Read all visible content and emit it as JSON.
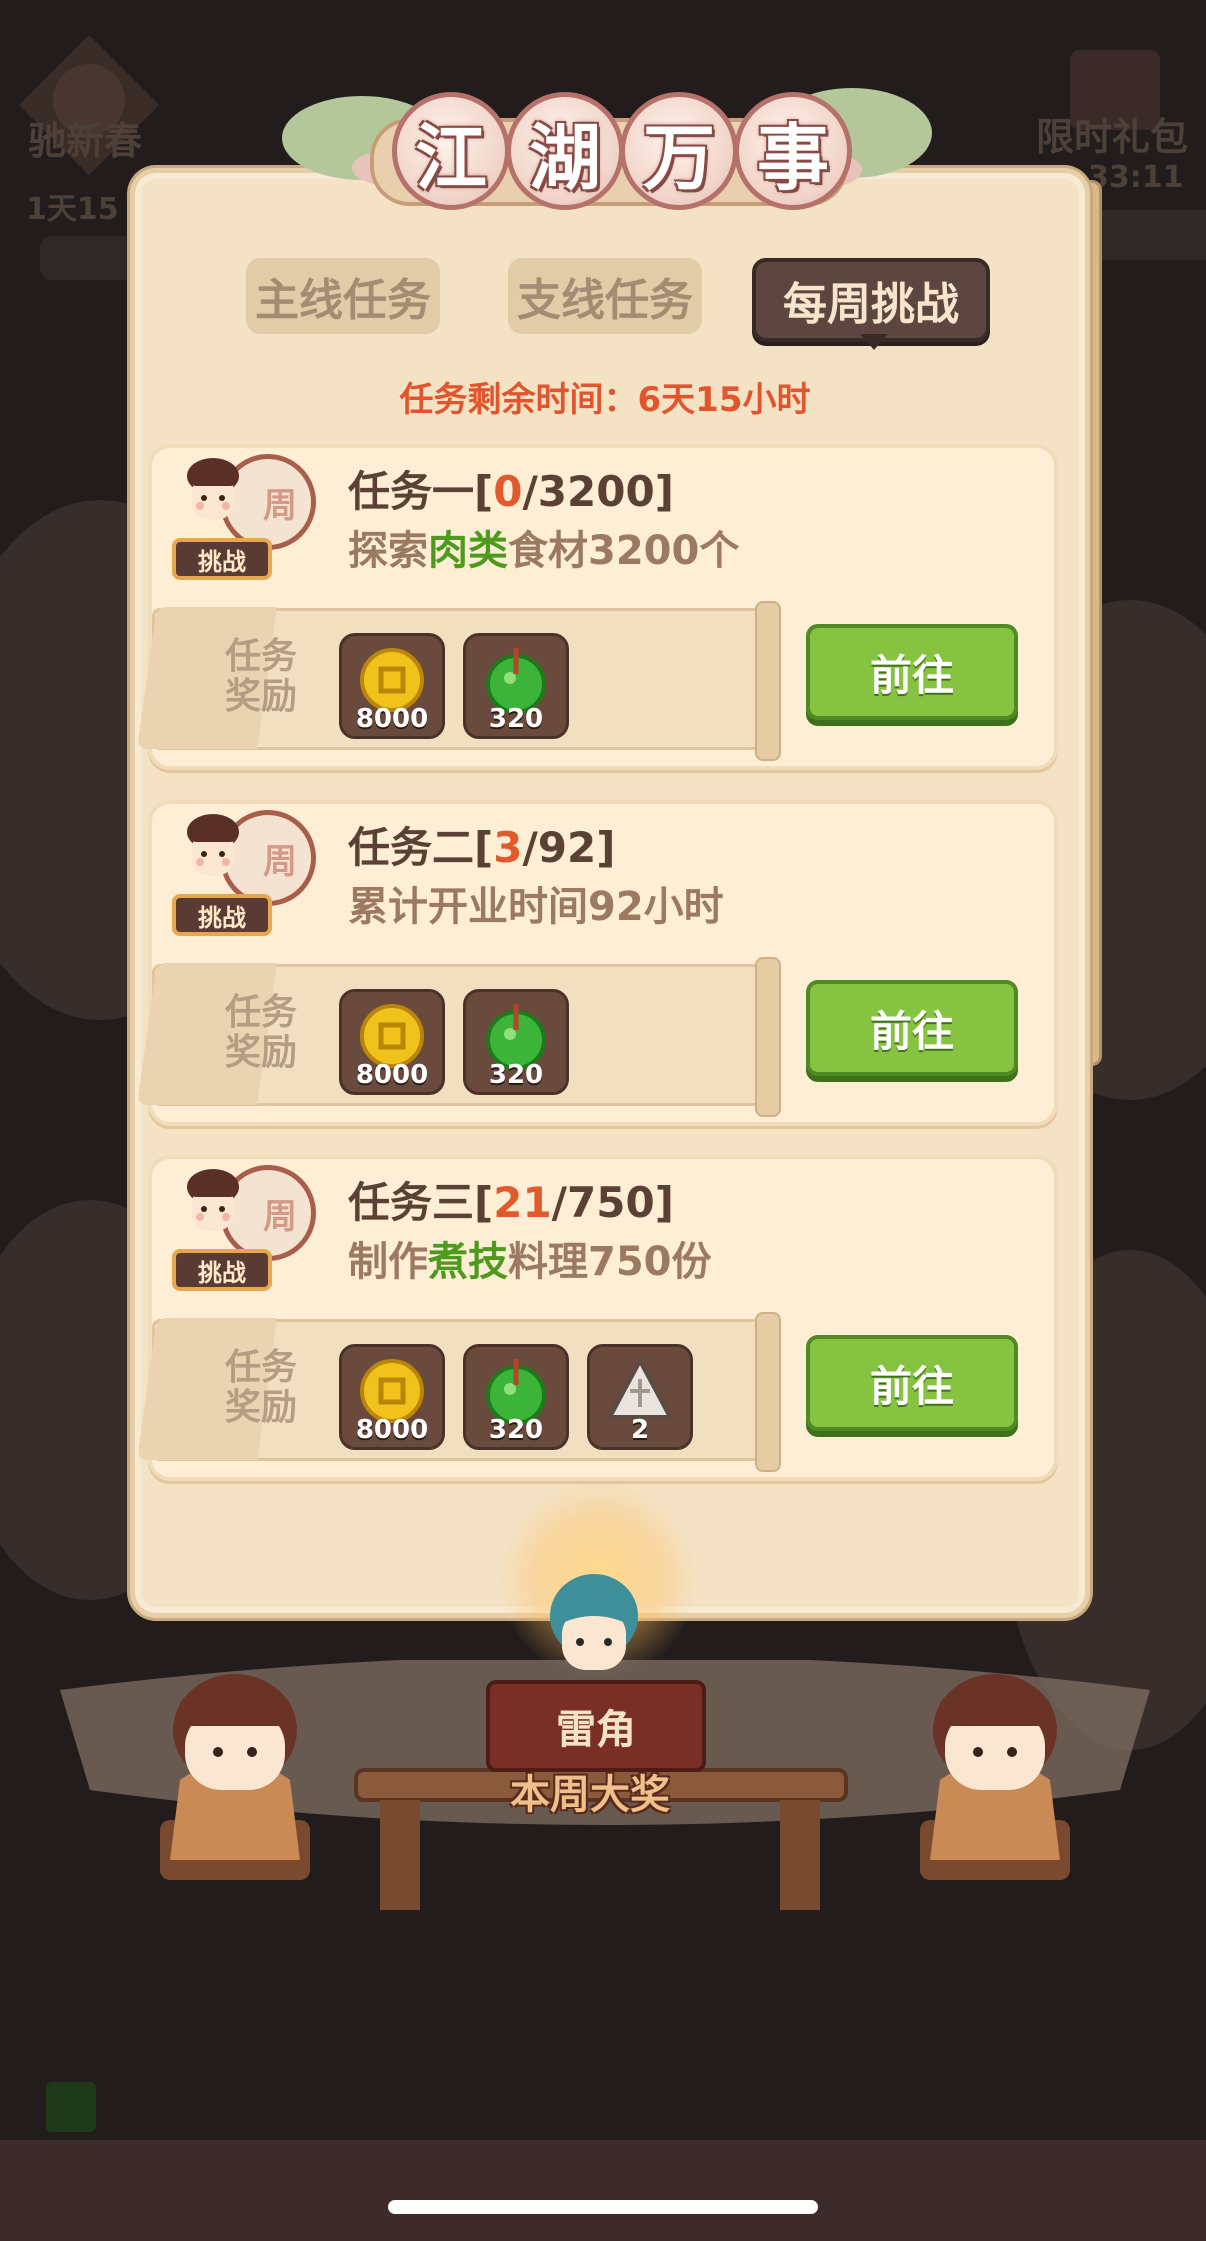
{
  "background": {
    "left_event_label": "驰新春",
    "left_event_timer": "1天15",
    "right_event_label": "限时礼包",
    "right_event_timer": "33:11"
  },
  "title": [
    "江",
    "湖",
    "万",
    "事"
  ],
  "tabs": [
    {
      "label": "主线任务",
      "active": false
    },
    {
      "label": "支线任务",
      "active": false
    },
    {
      "label": "每周挑战",
      "active": true
    }
  ],
  "remaining": {
    "label": "任务剩余时间：",
    "value": "6天15小时"
  },
  "card_common": {
    "badge_char": "周",
    "challenge_label": "挑战",
    "reward_label": "任务奖励",
    "go_label": "前往"
  },
  "tasks": [
    {
      "name": "任务一",
      "current": "0",
      "total": "3200",
      "desc_pre": "探索",
      "desc_hl": "肉类",
      "desc_post": "食材3200个",
      "rewards": [
        {
          "icon": "copper-coin-icon",
          "qty": "8000"
        },
        {
          "icon": "jade-pendant-icon",
          "qty": "320"
        }
      ]
    },
    {
      "name": "任务二",
      "current": "3",
      "total": "92",
      "desc_pre": "累计开业时间92小时",
      "desc_hl": "",
      "desc_post": "",
      "rewards": [
        {
          "icon": "copper-coin-icon",
          "qty": "8000"
        },
        {
          "icon": "jade-pendant-icon",
          "qty": "320"
        }
      ]
    },
    {
      "name": "任务三",
      "current": "21",
      "total": "750",
      "desc_pre": "制作",
      "desc_hl": "煮技",
      "desc_post": "料理750份",
      "rewards": [
        {
          "icon": "copper-coin-icon",
          "qty": "8000"
        },
        {
          "icon": "jade-pendant-icon",
          "qty": "320"
        },
        {
          "icon": "rice-dumpling-icon",
          "qty": "2"
        }
      ]
    }
  ],
  "prize": {
    "name": "雷角",
    "caption": "本周大奖"
  },
  "colors": {
    "accent_red": "#e0552d",
    "highlight_green": "#4e9a1f",
    "button_green": "#86c340"
  }
}
